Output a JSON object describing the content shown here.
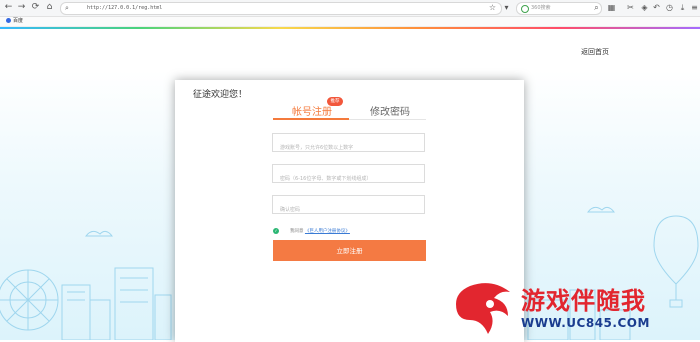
{
  "browser": {
    "url": "http://127.0.0.1/reg.html",
    "search_placeholder": "360搜索",
    "bookmark": "百度"
  },
  "header": {
    "home_link": "返回首页"
  },
  "card": {
    "welcome": "征途欢迎您！",
    "tabs": [
      {
        "label": "帐号注册",
        "active": true,
        "badge": "推荐"
      },
      {
        "label": "修改密码",
        "active": false
      }
    ],
    "fields": {
      "account_placeholder": "游戏账号，只允许6位数以上数字",
      "password_placeholder": "密码（6-16位字母、数字或下划线组成）",
      "confirm_placeholder": "确认密码"
    },
    "agreement_prefix": "我同意",
    "agreement_link": "《巨人用户注册协议》",
    "submit_label": "立即注册"
  },
  "watermark": {
    "title": "游戏伴随我",
    "url": "WWW.UC845.COM"
  },
  "colors": {
    "accent": "#f47a43",
    "badge": "#f2573b",
    "check": "#2bb673",
    "watermark_red": "#e2262f",
    "watermark_blue": "#1a3c8f"
  }
}
